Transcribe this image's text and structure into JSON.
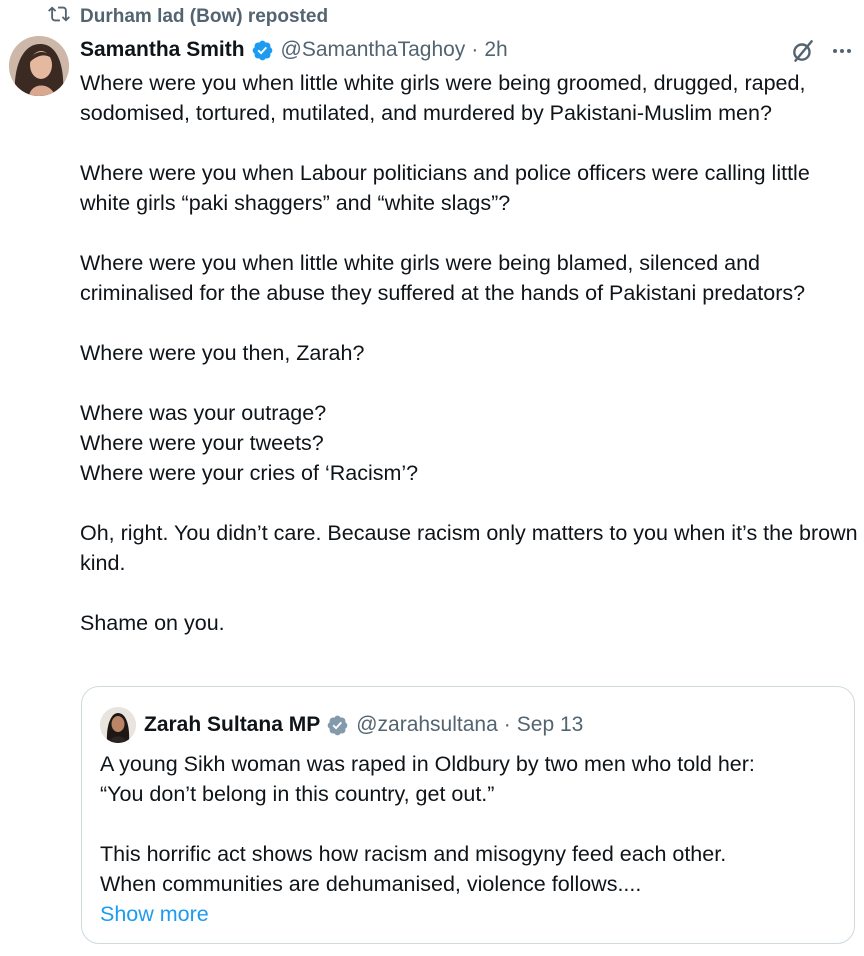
{
  "repost": {
    "icon": "repost-icon",
    "text": "Durham lad (Bow) reposted"
  },
  "tweet": {
    "author": {
      "name": "Samantha Smith",
      "verified": true,
      "handle": "@SamanthaTaghoy",
      "separator": "·",
      "time": "2h"
    },
    "text": "Where were you when little white girls were being groomed, drugged, raped, sodomised, tortured, mutilated, and murdered by Pakistani-Muslim men?\n\nWhere were you when Labour politicians and police officers were calling little white girls “paki shaggers” and “white slags”?\n\nWhere were you when little white girls were being blamed, silenced and criminalised for the abuse they suffered at the hands of Pakistani predators?\n\nWhere were you then, Zarah?\n\nWhere was your outrage?\nWhere were your tweets?\nWhere were your cries of ‘Racism’?\n\nOh, right. You didn’t care. Because racism only matters to you when it’s the brown kind.\n\nShame on you.",
    "actions": {
      "grok_icon": "grok-icon",
      "more_icon": "more-icon"
    }
  },
  "quoted_tweet": {
    "author": {
      "name": "Zarah Sultana MP",
      "verified": true,
      "verified_type": "government-grey",
      "handle": "@zarahsultana",
      "separator": "·",
      "time": "Sep 13"
    },
    "text": "A young Sikh woman was raped in Oldbury by two men who told her:\n“You don’t belong in this country, get out.”\n\nThis horrific act shows how racism and misogyny feed each other.\nWhen communities are dehumanised, violence follows....",
    "show_more": "Show more"
  },
  "colors": {
    "text_primary": "#0f1419",
    "text_secondary": "#536471",
    "link": "#1d9bf0",
    "verified_blue": "#1d9bf0",
    "verified_grey": "#829aab",
    "border": "#cfd9de"
  }
}
